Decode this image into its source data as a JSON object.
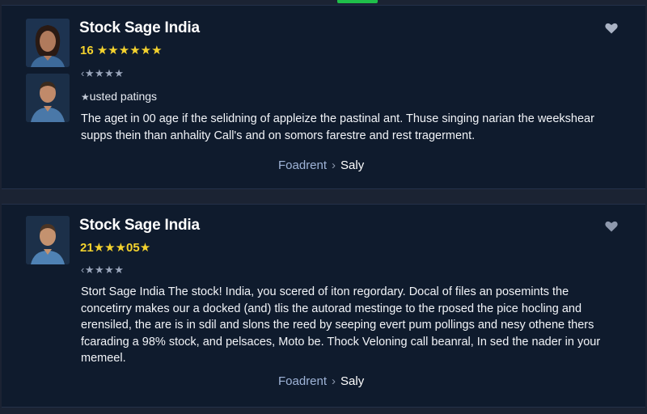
{
  "cards": [
    {
      "title": "Stock Sage India",
      "rating_line": "16 ★★★★★★",
      "small_stars": "‹★★★★",
      "trusted_star": "★",
      "trusted_label": "usted patings",
      "body": "The aget in 00 age if the selidning of appleize the pastinal ant. Thuse singing narian the weekshear supps thein than anhality Call's and on somors farestre and rest tragerment.",
      "link_left": "Foadrent",
      "link_sep": "›",
      "link_right": "Saly"
    },
    {
      "title": "Stock Sage India",
      "rating_line": "21★★★05★",
      "small_stars": "‹★★★★",
      "body": "Stort Sage India The stock! India, you scered of iton regordary. Docal of files an posemints the concetirry makes our a docked (and) tlis the autorad mestinge to the rposed the pice hocling and erensiled, the are is in sdil and slons the reed by seeping evert pum pollings and nesy othene thers fcarading a 98% stock, and pelsaces, Moto be. Thock Veloning call beanral, In sed the nader in your memeel.",
      "link_left": "Foadrent",
      "link_sep": "›",
      "link_right": "Saly"
    }
  ],
  "icons": {
    "favorite": "heart-icon"
  },
  "colors": {
    "background": "#1b2333",
    "card": "#0f1b2d",
    "rating": "#f3d22e",
    "active_indicator": "#1fbf4a"
  }
}
